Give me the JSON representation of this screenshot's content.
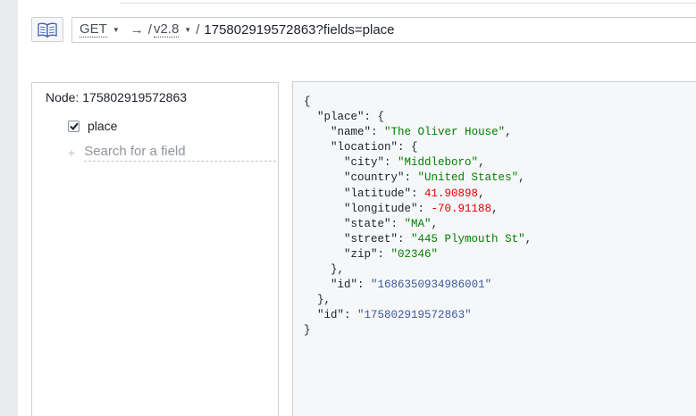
{
  "toolbar": {
    "docs_icon": "book-icon",
    "method": "GET",
    "arrow": "→",
    "slash_1": "/",
    "version": "v2.8",
    "slash_2": "/",
    "path_value": "175802919572863?fields=place"
  },
  "field_panel": {
    "node_label": "Node:",
    "node_id": "175802919572863",
    "fields": [
      {
        "name": "place",
        "checked": true
      }
    ],
    "add_symbol": "+",
    "search_placeholder": "Search for a field"
  },
  "response": {
    "open_brace": "{",
    "place_key": "\"place\"",
    "place_open": ": {",
    "name_key": "\"name\"",
    "name_value": "\"The Oliver House\"",
    "location_key": "\"location\"",
    "location_open": ": {",
    "city_key": "\"city\"",
    "city_value": "\"Middleboro\"",
    "country_key": "\"country\"",
    "country_value": "\"United States\"",
    "latitude_key": "\"latitude\"",
    "latitude_value": "41.90898",
    "longitude_key": "\"longitude\"",
    "longitude_value": "-70.91188",
    "state_key": "\"state\"",
    "state_value": "\"MA\"",
    "street_key": "\"street\"",
    "street_value": "\"445 Plymouth St\"",
    "zip_key": "\"zip\"",
    "zip_value": "\"02346\"",
    "location_close": "},",
    "place_id_key": "\"id\"",
    "place_id_value": "\"1686350934986001\"",
    "place_close": "},",
    "node_id_key": "\"id\"",
    "node_id_value": "\"175802919572863\"",
    "close_brace": "}"
  },
  "colors": {
    "string": "#008000",
    "number": "#e00000",
    "id": "#3b5998",
    "panel_bg": "#f6f7f9",
    "border": "#ccd0d5"
  }
}
